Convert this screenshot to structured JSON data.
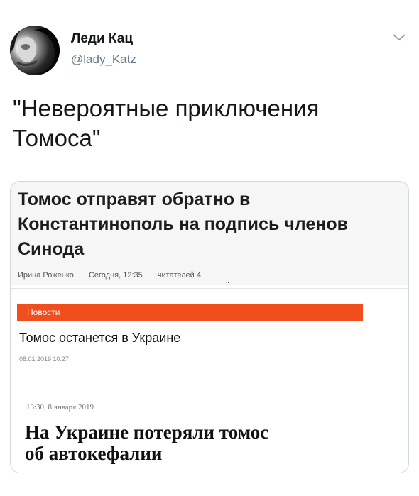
{
  "author": {
    "name": "Леди Кац",
    "handle": "@lady_Katz"
  },
  "tweet": {
    "text_line1": "\"Невероятные приключения",
    "text_line2": "Томоса\""
  },
  "icons": {
    "avatar": "avatar-photo",
    "menu": "chevron-down-icon"
  },
  "card": {
    "article1": {
      "title_line1": "Томос отправят обратно в",
      "title_line2": "Константинополь на подпись членов",
      "title_line3": "Синода",
      "author": "Ирина Роженко",
      "time": "Сегодня, 12:35",
      "readers": "читателей 4"
    },
    "article2": {
      "section": "Новости",
      "title": "Томос останется в Украине",
      "date": "08.01.2019 10:27"
    },
    "article3": {
      "date": "13:30, 8 января 2019",
      "title_line1": "На Украине потеряли томос",
      "title_line2": "об автокефалии"
    }
  },
  "colors": {
    "accent_orange": "#f14e1e",
    "handle_grey": "#657786",
    "text_dark": "#14171a"
  }
}
